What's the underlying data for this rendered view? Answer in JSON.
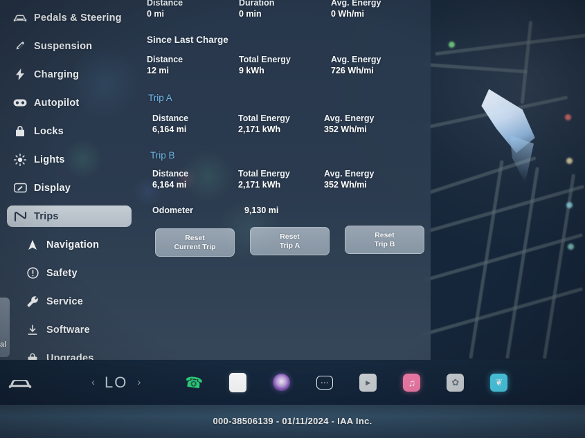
{
  "sidebar": {
    "items": [
      {
        "label": "Pedals & Steering",
        "icon": "car-icon",
        "level": "top",
        "active": false
      },
      {
        "label": "Suspension",
        "icon": "suspension-icon",
        "level": "top",
        "active": false
      },
      {
        "label": "Charging",
        "icon": "bolt-icon",
        "level": "top",
        "active": false
      },
      {
        "label": "Autopilot",
        "icon": "autopilot-icon",
        "level": "top",
        "active": false
      },
      {
        "label": "Locks",
        "icon": "lock-icon",
        "level": "top",
        "active": false
      },
      {
        "label": "Lights",
        "icon": "sun-icon",
        "level": "top",
        "active": false
      },
      {
        "label": "Display",
        "icon": "display-icon",
        "level": "top",
        "active": false
      },
      {
        "label": "Trips",
        "icon": "trips-icon",
        "level": "top",
        "active": true
      },
      {
        "label": "Navigation",
        "icon": "navigation-icon",
        "level": "sub",
        "active": false
      },
      {
        "label": "Safety",
        "icon": "info-icon",
        "level": "sub",
        "active": false
      },
      {
        "label": "Service",
        "icon": "wrench-icon",
        "level": "sub",
        "active": false
      },
      {
        "label": "Software",
        "icon": "download-icon",
        "level": "sub",
        "active": false
      },
      {
        "label": "Upgrades",
        "icon": "bag-icon",
        "level": "sub",
        "active": false
      }
    ]
  },
  "content": {
    "current_trip": {
      "stats": [
        {
          "key": "Distance",
          "value": "0 mi"
        },
        {
          "key": "Duration",
          "value": "0 min"
        },
        {
          "key": "Avg. Energy",
          "value": "0 Wh/mi"
        }
      ]
    },
    "since_last_charge": {
      "title": "Since Last Charge",
      "stats": [
        {
          "key": "Distance",
          "value": "12 mi"
        },
        {
          "key": "Total Energy",
          "value": "9 kWh"
        },
        {
          "key": "Avg. Energy",
          "value": "726 Wh/mi"
        }
      ]
    },
    "trip_a": {
      "title": "Trip A",
      "stats": [
        {
          "key": "Distance",
          "value": "6,164 mi"
        },
        {
          "key": "Total Energy",
          "value": "2,171 kWh"
        },
        {
          "key": "Avg. Energy",
          "value": "352 Wh/mi"
        }
      ]
    },
    "trip_b": {
      "title": "Trip B",
      "stats": [
        {
          "key": "Distance",
          "value": "6,164 mi"
        },
        {
          "key": "Total Energy",
          "value": "2,171 kWh"
        },
        {
          "key": "Avg. Energy",
          "value": "352 Wh/mi"
        }
      ]
    },
    "odometer": {
      "label": "Odometer",
      "value": "9,130 mi"
    },
    "buttons": [
      {
        "line1": "Reset",
        "line2": "Current Trip"
      },
      {
        "line1": "Reset",
        "line2": "Trip A"
      },
      {
        "line1": "Reset",
        "line2": "Trip B"
      }
    ],
    "accent_color": "#6fb7e8"
  },
  "dock": {
    "car_icon": "car-icon",
    "climate": {
      "prev": "‹",
      "temp": "LO",
      "next": "›"
    },
    "apps": [
      {
        "name": "phone-app-icon",
        "glyph": "✆",
        "color": "#2fd27a",
        "bg": "transparent"
      },
      {
        "name": "media-app-icon",
        "glyph": "",
        "color": "#ffffff",
        "bg": "#f4f6f7"
      },
      {
        "name": "spotify-app-icon",
        "glyph": "◉",
        "color": "#e8dff5",
        "bg": "#8a5fb8"
      },
      {
        "name": "messages-app-icon",
        "glyph": "•••",
        "color": "#ffffff",
        "bg": "transparent"
      },
      {
        "name": "theater-app-icon",
        "glyph": "▶",
        "color": "#4a5560",
        "bg": "#c9ced3"
      },
      {
        "name": "music-app-icon",
        "glyph": "♫",
        "color": "#ffffff",
        "bg": "#f07ba8"
      },
      {
        "name": "toybox-app-icon",
        "glyph": "✿",
        "color": "#6c7780",
        "bg": "#cdd3d8"
      },
      {
        "name": "bird-app-icon",
        "glyph": "❦",
        "color": "#ffffff",
        "bg": "#4fd4f0"
      }
    ]
  },
  "watermark": {
    "text": "000-38506139 - 01/11/2024 - IAA Inc."
  },
  "edge_ghost": {
    "text": "al"
  }
}
